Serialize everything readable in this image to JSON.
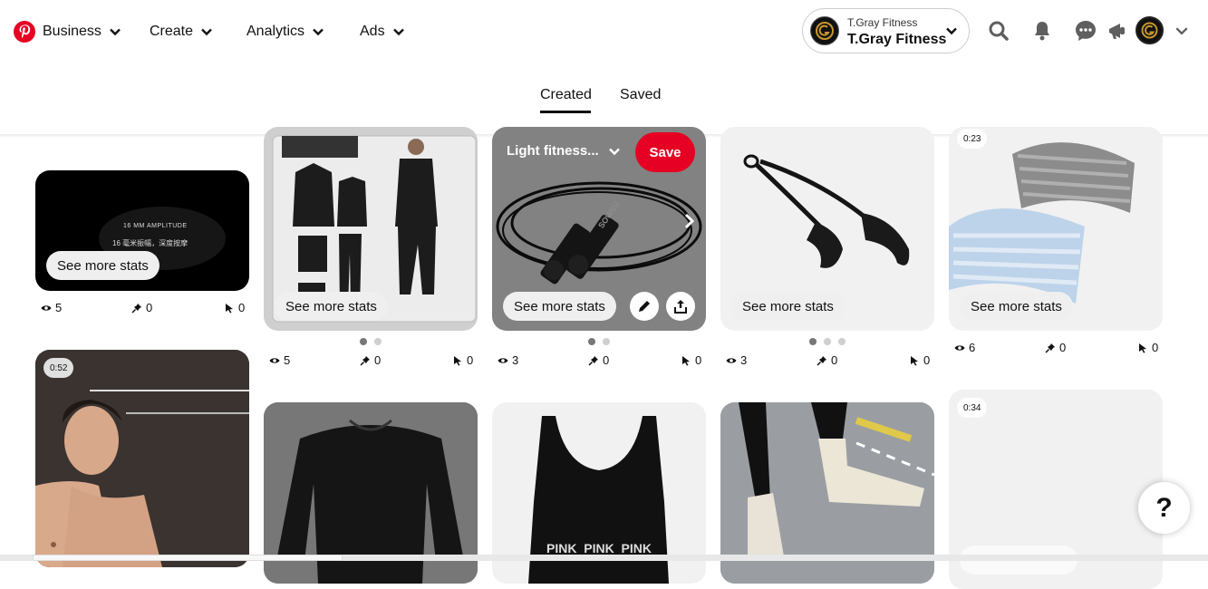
{
  "nav": {
    "business": "Business",
    "create": "Create",
    "analytics": "Analytics",
    "ads": "Ads"
  },
  "account": {
    "small_name": "T.Gray Fitness",
    "name": "T.Gray Fitness"
  },
  "icons": {
    "logo": "pinterest-logo",
    "search": "search-icon",
    "bell": "notifications-bell-icon",
    "messages": "messages-icon",
    "updates": "megaphone-icon",
    "account_menu": "chevron-down-icon"
  },
  "tabs": [
    {
      "label": "Created",
      "active": true
    },
    {
      "label": "Saved",
      "active": false
    }
  ],
  "colors": {
    "brand_red": "#E60023",
    "pill_bg": "#EFEFEF",
    "text": "#111111"
  },
  "pins": [
    {
      "stats_label": "See more stats",
      "views": "5",
      "saves": "0",
      "clicks": "0",
      "image_text_1": "16 MM AMPLITUDE",
      "image_text_2": "16 毫米振幅，深度按摩"
    },
    {
      "stats_label": "See more stats",
      "views": "5",
      "saves": "0",
      "clicks": "0",
      "carousel_dots": 2
    },
    {
      "stats_label": "See more stats",
      "views": "3",
      "saves": "0",
      "clicks": "0",
      "carousel_dots": 2,
      "hover_title": "Light fitness...",
      "save_label": "Save",
      "image_text": "SOWEU"
    },
    {
      "stats_label": "See more stats",
      "views": "3",
      "saves": "0",
      "clicks": "0",
      "carousel_dots": 3
    },
    {
      "stats_label": "See more stats",
      "views": "6",
      "saves": "0",
      "clicks": "0",
      "video_time": "0:23"
    },
    {
      "video_time": "0:52"
    },
    {},
    {
      "image_text": "PINK  PINK  PINK"
    },
    {},
    {
      "video_time": "0:34"
    }
  ],
  "help_label": "?"
}
